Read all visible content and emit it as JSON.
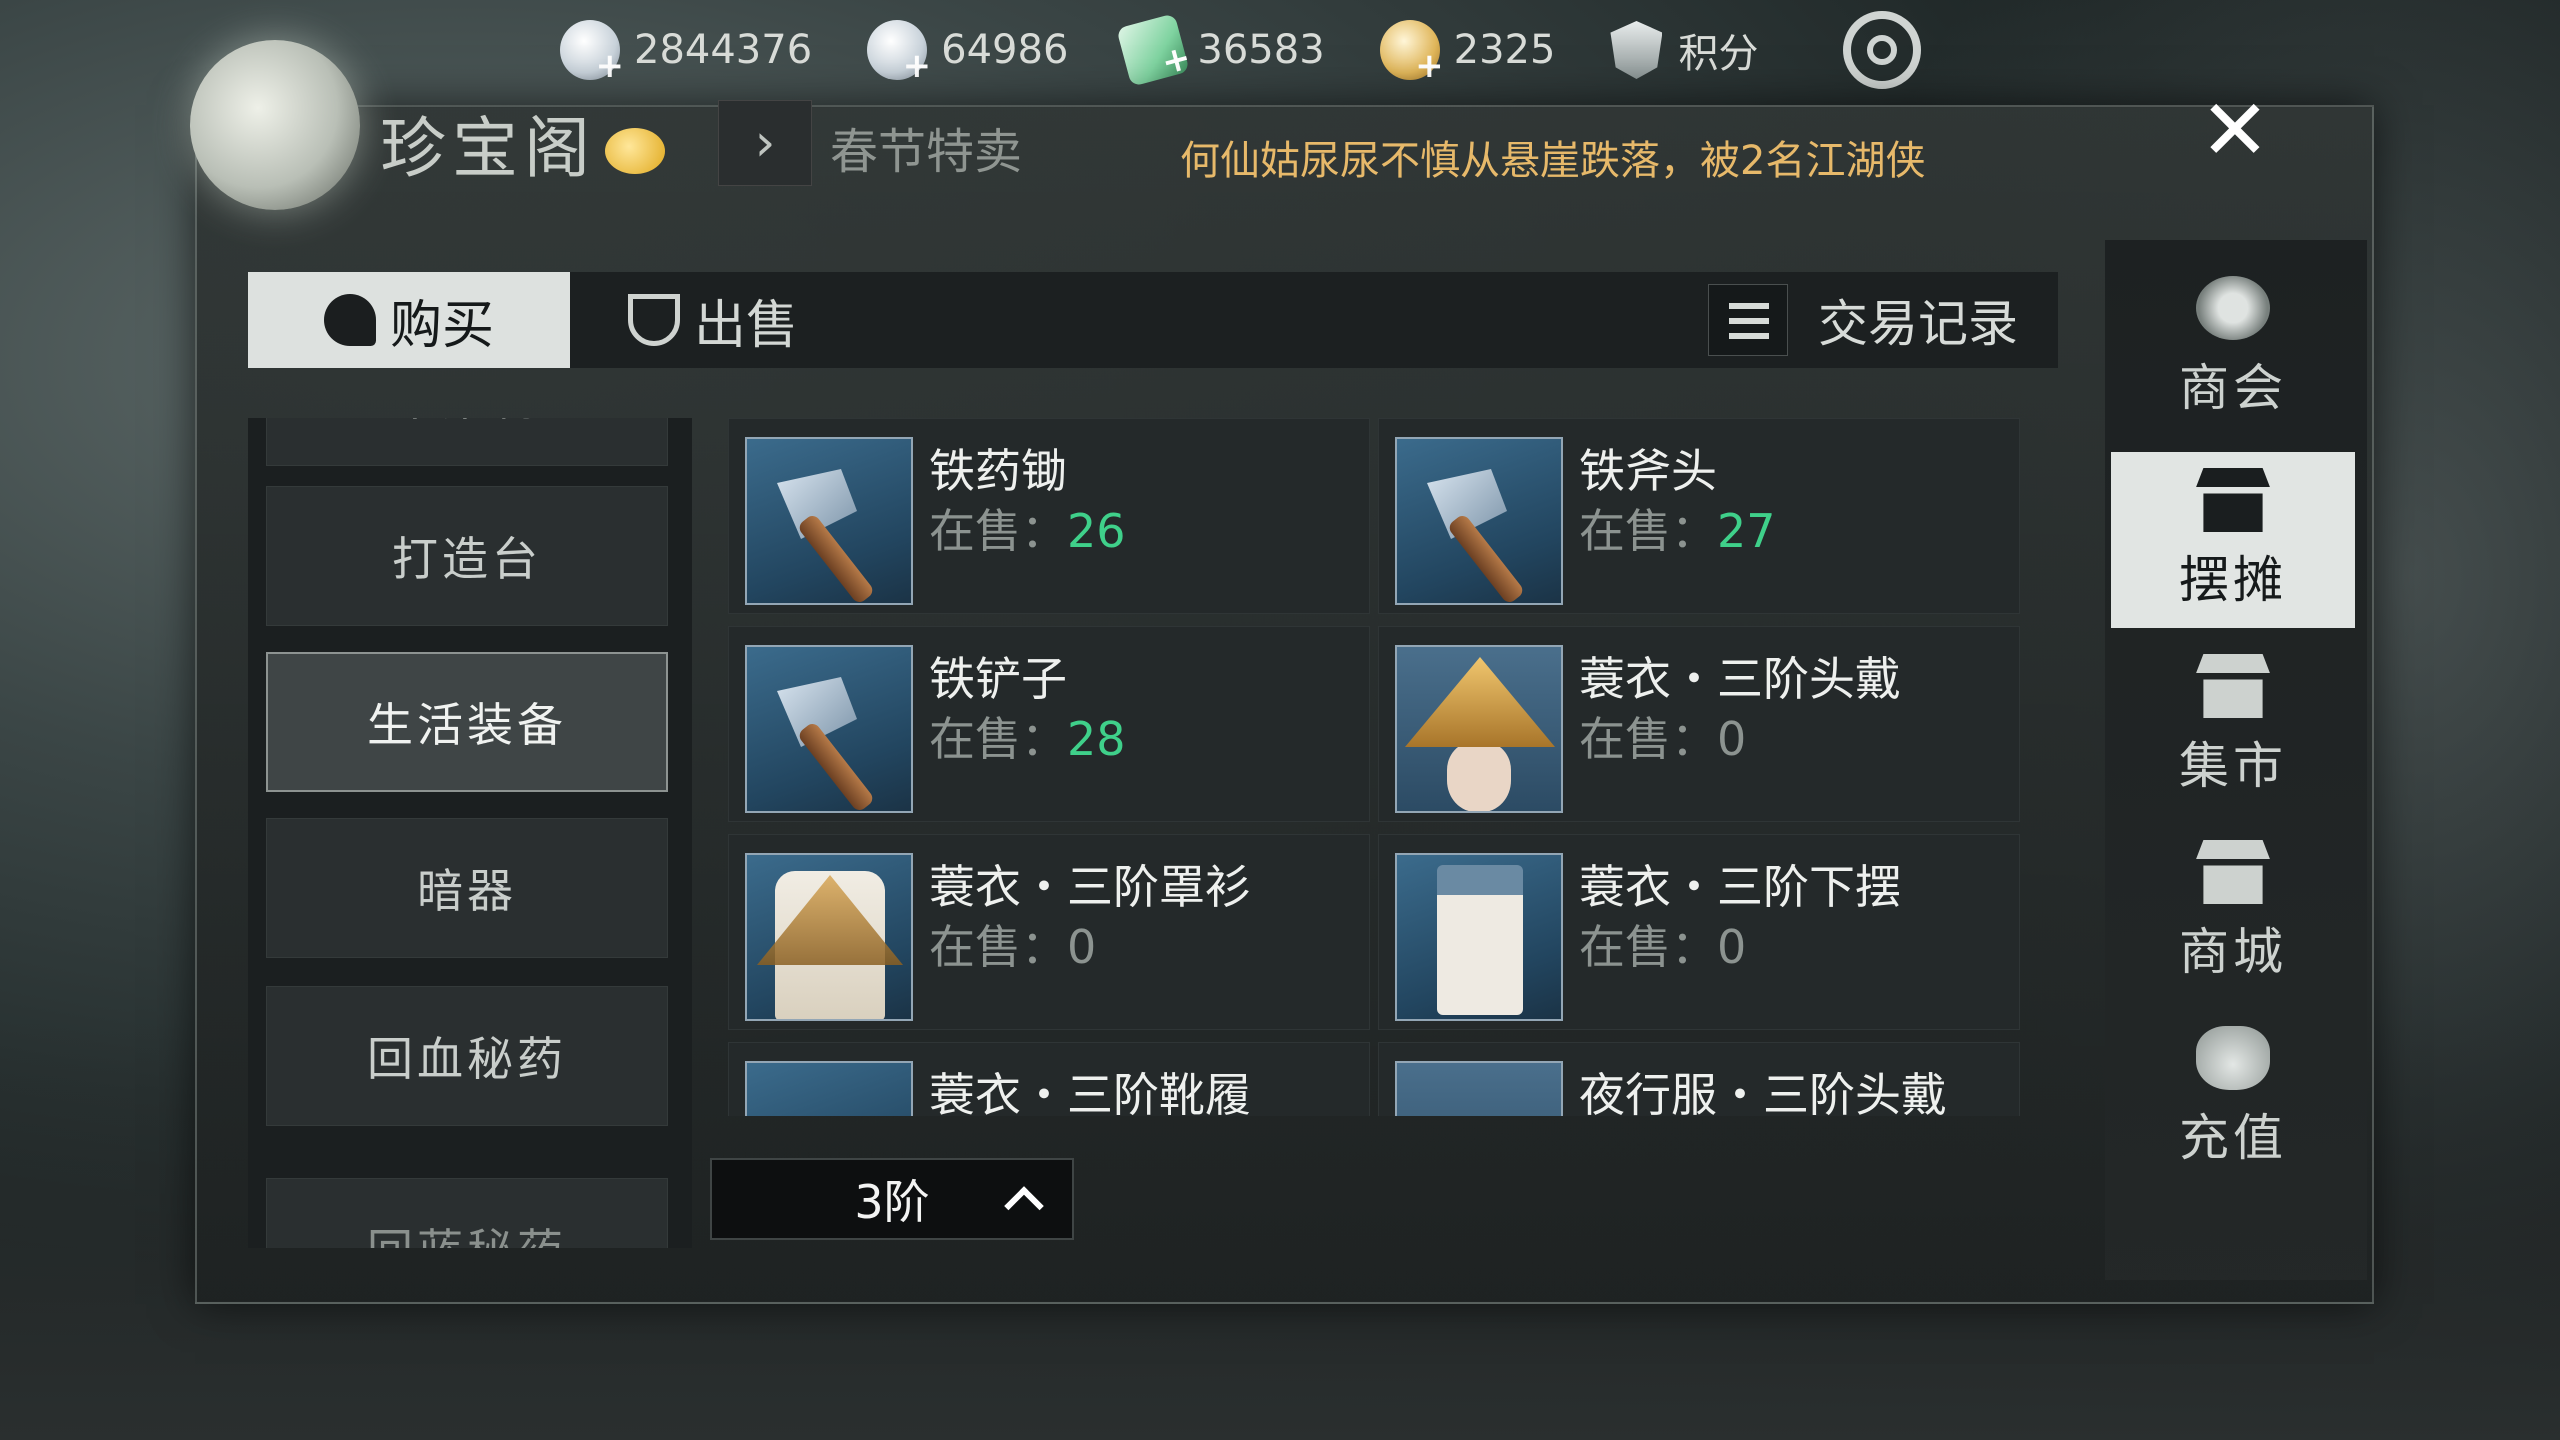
{
  "currencies": [
    {
      "icon": "coin-icon",
      "value": "2844376"
    },
    {
      "icon": "silver-ingot-icon",
      "value": "64986"
    },
    {
      "icon": "jade-icon",
      "value": "36583"
    },
    {
      "icon": "gold-ingot-icon",
      "value": "2325"
    }
  ],
  "score_label": "积分",
  "shop": {
    "title": "珍宝阁",
    "breadcrumb": "春节特卖",
    "announcement": "何仙姑尿尿不慎从悬崖跌落，被2名江湖侠"
  },
  "tabs": {
    "buy": "购买",
    "sell": "出售",
    "records": "交易记录"
  },
  "categories": [
    {
      "label": "采集物",
      "state": "partial"
    },
    {
      "label": "打造台",
      "state": "normal"
    },
    {
      "label": "生活装备",
      "state": "active"
    },
    {
      "label": "暗器",
      "state": "normal"
    },
    {
      "label": "回血秘药",
      "state": "normal"
    },
    {
      "label": "回蓝秘药",
      "state": "partial"
    }
  ],
  "stock_label": "在售：",
  "items": [
    {
      "name": "铁药锄",
      "stock": "26",
      "thumb": "axe"
    },
    {
      "name": "铁斧头",
      "stock": "27",
      "thumb": "axe"
    },
    {
      "name": "铁铲子",
      "stock": "28",
      "thumb": "axe"
    },
    {
      "name": "蓑衣・三阶头戴",
      "stock": "0",
      "thumb": "hat"
    },
    {
      "name": "蓑衣・三阶罩衫",
      "stock": "0",
      "thumb": "robe"
    },
    {
      "name": "蓑衣・三阶下摆",
      "stock": "0",
      "thumb": "skirt"
    },
    {
      "name": "蓑衣・三阶靴履",
      "stock": "",
      "thumb": "axe"
    },
    {
      "name": "夜行服・三阶头戴",
      "stock": "",
      "thumb": "hat"
    }
  ],
  "tier_filter": "3阶",
  "side_nav": [
    {
      "label": "商会",
      "icon": "emblem",
      "active": false
    },
    {
      "label": "摆摊",
      "icon": "stall",
      "active": true
    },
    {
      "label": "集市",
      "icon": "stall",
      "active": false
    },
    {
      "label": "商城",
      "icon": "stall",
      "active": false
    },
    {
      "label": "充值",
      "icon": "bag",
      "active": false
    }
  ]
}
